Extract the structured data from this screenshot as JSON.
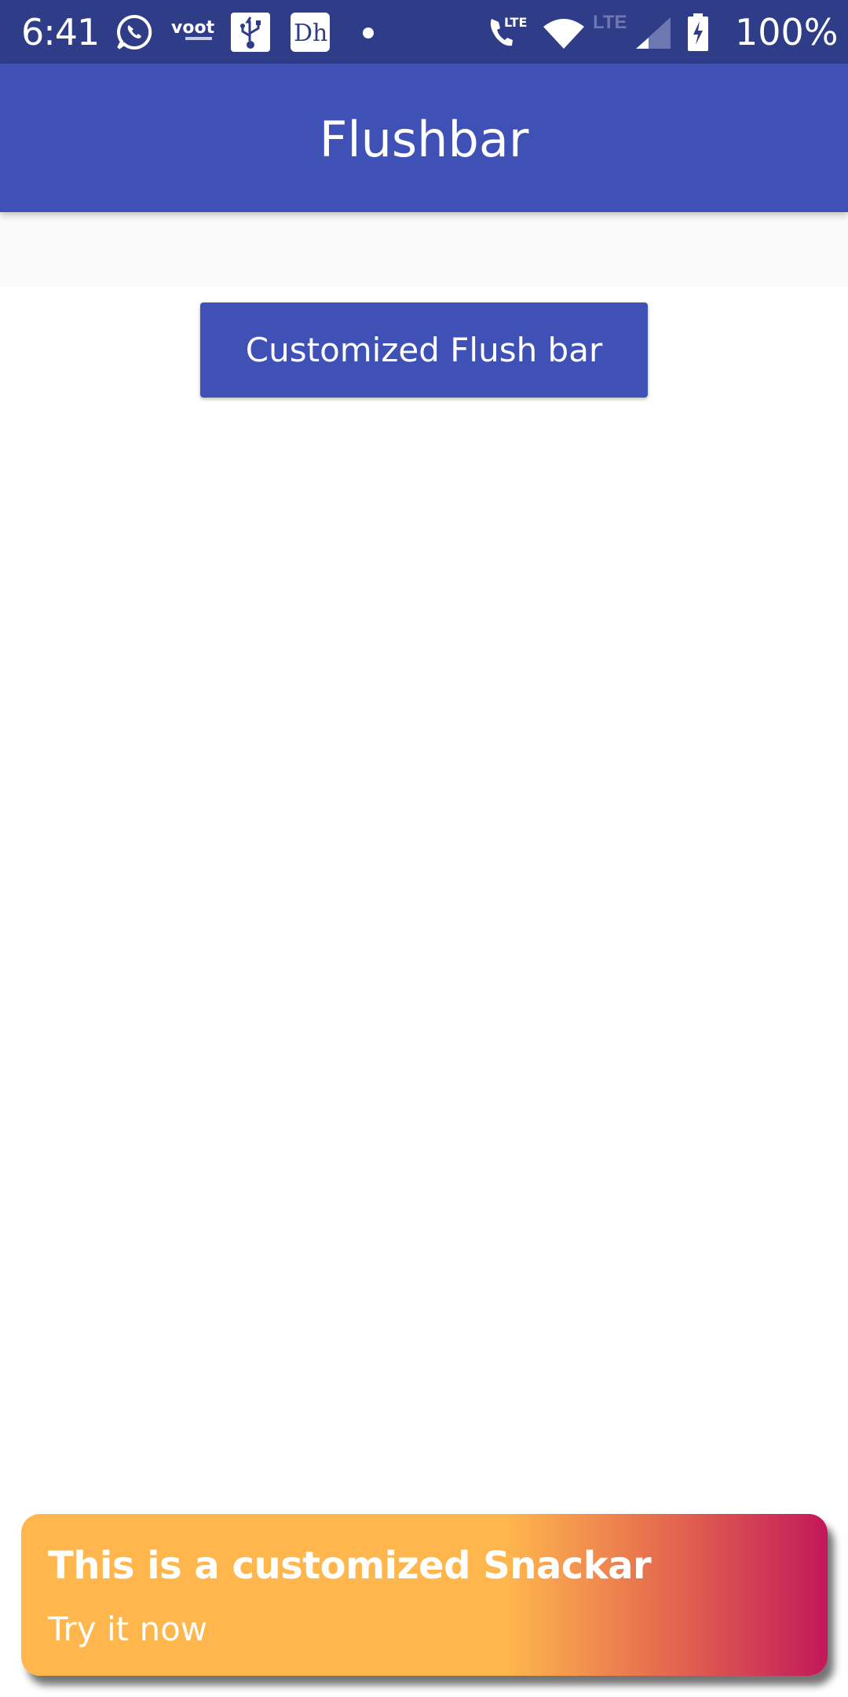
{
  "status_bar": {
    "time": "6:41",
    "battery_percent": "100%",
    "lte_label": "LTE",
    "icons": [
      "whatsapp-icon",
      "voot-icon",
      "usb-icon",
      "hotstar-icon",
      "dot-icon",
      "call-lte-icon",
      "wifi-icon",
      "signal-icon",
      "battery-charging-icon"
    ]
  },
  "app_bar": {
    "title": "Flushbar"
  },
  "main": {
    "button_label": "Customized Flush bar"
  },
  "snackbar": {
    "title": "This is a customized Snackar",
    "message": "Try it now"
  },
  "colors": {
    "status_bar": "#2f3c88",
    "primary": "#3f51b5",
    "snackbar_gradient_start": "#ffb74d",
    "snackbar_gradient_end": "#c2185b"
  }
}
